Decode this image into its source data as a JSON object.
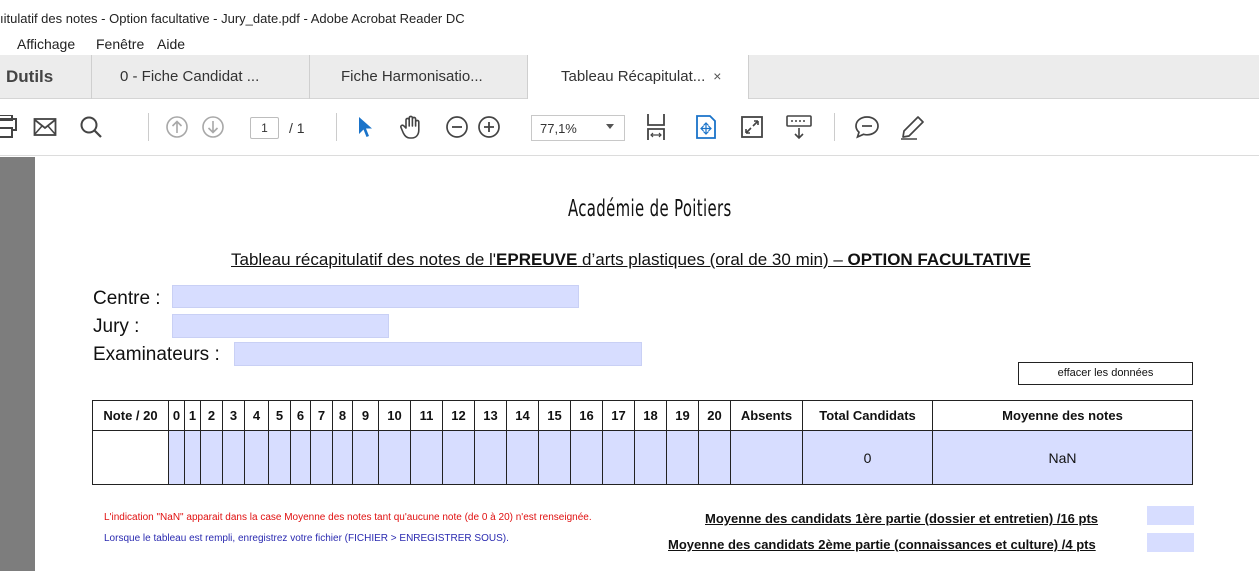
{
  "window": {
    "title": "ıitulatif des notes - Option facultative - Jury_date.pdf - Adobe Acrobat Reader DC"
  },
  "menu": {
    "items": [
      "Affichage",
      "Fenêtre",
      "Aide"
    ]
  },
  "tabs": {
    "tools": "Dutils",
    "items": [
      {
        "label": "0 - Fiche Candidat ..."
      },
      {
        "label": "Fiche Harmonisatio..."
      },
      {
        "label": "Tableau Récapitulat...",
        "close": "×"
      }
    ]
  },
  "toolbar": {
    "page_current": "1",
    "page_total": "/ 1",
    "zoom": "77,1%",
    "accent": "#1a73c9",
    "icons": [
      "print-icon",
      "mail-icon",
      "search-icon",
      "prev-page-icon",
      "next-page-icon",
      "select-cursor-icon",
      "hand-icon",
      "zoom-out-icon",
      "zoom-in-icon",
      "fit-page-icon",
      "scroll-mode-icon",
      "fullscreen-icon",
      "keyboard-icon",
      "comment-icon",
      "pen-icon"
    ]
  },
  "document": {
    "title": "Académie de Poitiers",
    "subtitle_pre": "Tableau récapitulatif des notes de l'",
    "subtitle_bold1": "EPREUVE",
    "subtitle_mid": " d’arts plastiques (oral de 30 min) – ",
    "subtitle_bold2": "OPTION FACULTATIVE",
    "fields": {
      "centre": "Centre :",
      "jury": "Jury :",
      "examinateurs": "Examinateurs :"
    },
    "clear_button": "effacer les données",
    "table": {
      "first_header": "Note / 20",
      "grades": [
        "0",
        "1",
        "2",
        "3",
        "4",
        "5",
        "6",
        "7",
        "8",
        "9",
        "10",
        "11",
        "12",
        "13",
        "14",
        "15",
        "16",
        "17",
        "18",
        "19",
        "20"
      ],
      "absents": "Absents",
      "total": "Total Candidats",
      "moyenne": "Moyenne des notes",
      "total_value": "0",
      "moyenne_value": "NaN"
    },
    "note_red": "L'indication \"NaN\" apparait dans la case Moyenne des notes tant qu'aucune note (de 0 à 20) n'est renseignée.",
    "note_blue": "Lorsque le tableau est rempli, enregistrez votre fichier (FICHIER > ENREGISTRER SOUS).",
    "avg1": "Moyenne des candidats 1ère partie (dossier et entretien) /16 pts",
    "avg2": "Moyenne des candidats 2ème partie (connaissances et culture) /4 pts"
  }
}
